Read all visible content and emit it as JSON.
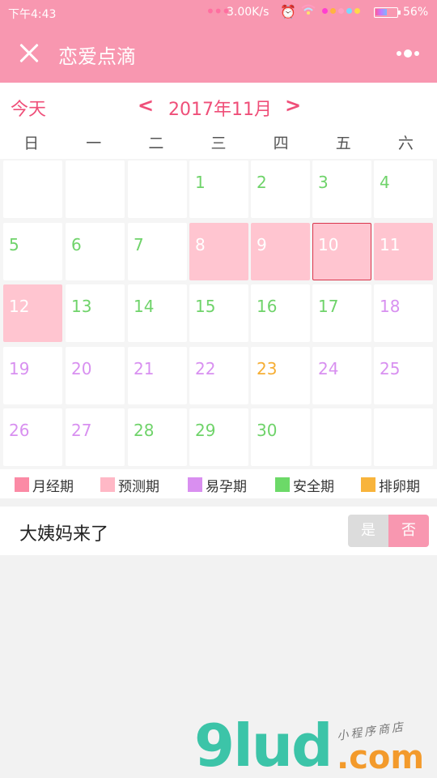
{
  "status_bar": {
    "time": "下午4:43",
    "speed": "3.00K/s",
    "battery": "56%",
    "colors": [
      "#ff3fd0",
      "#ffb340",
      "#ff9fc0",
      "#7ad8ff",
      "#ffd94a"
    ]
  },
  "header": {
    "title": "恋爱点滴",
    "close_icon": "close-icon",
    "more_icon": "more-icon"
  },
  "calendar": {
    "today_label": "今天",
    "prev_label": "<",
    "next_label": ">",
    "month_label": "2017年11月",
    "weekdays": [
      "日",
      "一",
      "二",
      "三",
      "四",
      "五",
      "六"
    ],
    "days": [
      {
        "d": "",
        "type": "empty"
      },
      {
        "d": "",
        "type": "empty"
      },
      {
        "d": "",
        "type": "empty"
      },
      {
        "d": "1",
        "type": "safe"
      },
      {
        "d": "2",
        "type": "safe"
      },
      {
        "d": "3",
        "type": "safe"
      },
      {
        "d": "4",
        "type": "safe"
      },
      {
        "d": "5",
        "type": "safe"
      },
      {
        "d": "6",
        "type": "safe"
      },
      {
        "d": "7",
        "type": "safe"
      },
      {
        "d": "8",
        "type": "predicted"
      },
      {
        "d": "9",
        "type": "predicted"
      },
      {
        "d": "10",
        "type": "predicted",
        "selected": true
      },
      {
        "d": "11",
        "type": "predicted"
      },
      {
        "d": "12",
        "type": "predicted"
      },
      {
        "d": "13",
        "type": "safe"
      },
      {
        "d": "14",
        "type": "safe"
      },
      {
        "d": "15",
        "type": "safe"
      },
      {
        "d": "16",
        "type": "safe"
      },
      {
        "d": "17",
        "type": "safe"
      },
      {
        "d": "18",
        "type": "fertile"
      },
      {
        "d": "19",
        "type": "fertile"
      },
      {
        "d": "20",
        "type": "fertile"
      },
      {
        "d": "21",
        "type": "fertile"
      },
      {
        "d": "22",
        "type": "fertile"
      },
      {
        "d": "23",
        "type": "ovulation"
      },
      {
        "d": "24",
        "type": "fertile"
      },
      {
        "d": "25",
        "type": "fertile"
      },
      {
        "d": "26",
        "type": "fertile"
      },
      {
        "d": "27",
        "type": "fertile"
      },
      {
        "d": "28",
        "type": "safe"
      },
      {
        "d": "29",
        "type": "safe"
      },
      {
        "d": "30",
        "type": "safe"
      },
      {
        "d": "",
        "type": "empty"
      },
      {
        "d": "",
        "type": "empty"
      }
    ]
  },
  "legend": [
    {
      "label": "月经期",
      "color": "#fb8aa5"
    },
    {
      "label": "预测期",
      "color": "#ffb8c6"
    },
    {
      "label": "易孕期",
      "color": "#d98ff0"
    },
    {
      "label": "安全期",
      "color": "#6cd968"
    },
    {
      "label": "排卵期",
      "color": "#f8b43c"
    }
  ],
  "period_toggle": {
    "label": "大姨妈来了",
    "yes": "是",
    "no": "否"
  },
  "watermark": {
    "logo": "9lud",
    "suffix": ".com",
    "tagline": "小程序商店"
  }
}
